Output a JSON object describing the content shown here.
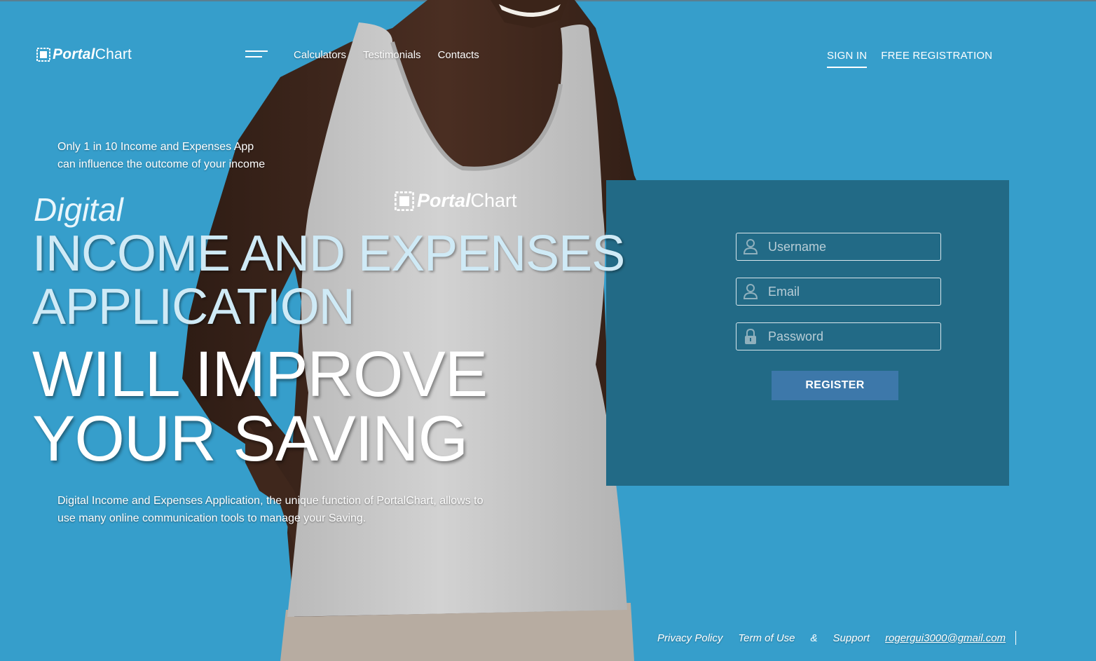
{
  "brand": {
    "bold": "Portal",
    "regular": "Chart"
  },
  "nav": [
    {
      "label": "Calculators"
    },
    {
      "label": "Testimonials"
    },
    {
      "label": "Contacts"
    }
  ],
  "auth": {
    "signin": "SIGN IN",
    "register": "FREE REGISTRATION"
  },
  "hero": {
    "tagline_line1": "Only 1 in 10 Income and Expenses App",
    "tagline_line2": "can influence the outcome of your income",
    "digital": "Digital",
    "headline_line1": "INCOME AND EXPENSES",
    "headline_line2": "APPLICATION",
    "headline2_line1": "WILL IMPROVE",
    "headline2_line2": "YOUR SAVING",
    "description_line1": "Digital Income and Expenses Application, the unique function of PortalChart, allows to",
    "description_line2": "use many online communication tools to manage your Saving.",
    "shirt_logo_bold": "Portal",
    "shirt_logo_regular": "Chart"
  },
  "form": {
    "username_placeholder": "Username",
    "email_placeholder": "Email",
    "password_placeholder": "Password",
    "register_label": "REGISTER",
    "icons": [
      "user-icon",
      "user-icon",
      "lock-icon"
    ]
  },
  "footer": {
    "privacy": "Privacy Policy",
    "terms": "Term of Use",
    "amp": "&",
    "support": "Support",
    "email": "rogergui3000@gmail.com"
  },
  "colors": {
    "background": "#369ecb",
    "panel": "#226a86",
    "button": "#3d78aa",
    "shirt": "#c9c9c9",
    "skin": "#3a2419"
  }
}
